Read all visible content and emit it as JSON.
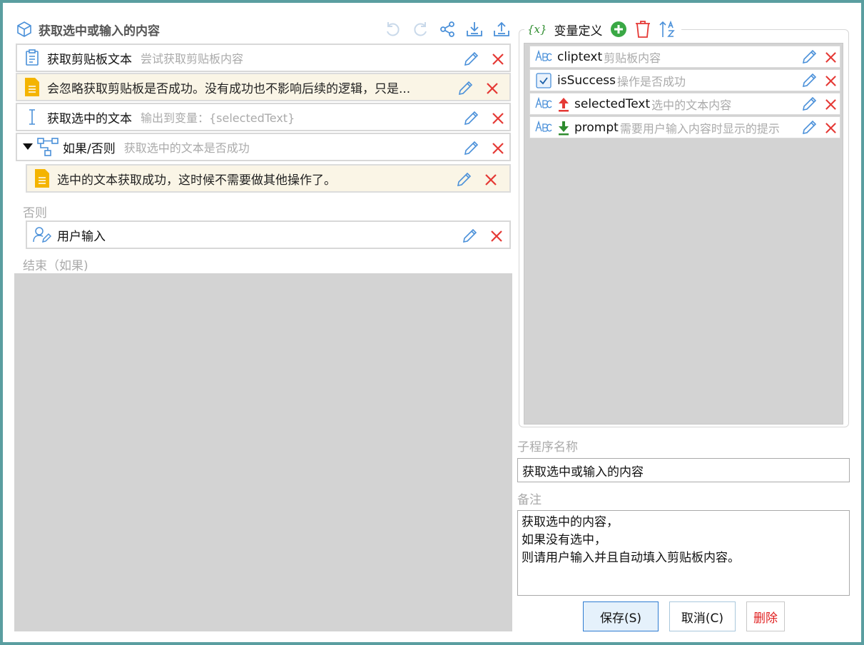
{
  "header": {
    "title": "获取选中或输入的内容"
  },
  "steps": [
    {
      "name": "获取剪贴板文本",
      "desc": "尝试获取剪贴板内容"
    },
    {
      "note": "会忽略获取剪贴板是否成功。没有成功也不影响后续的逻辑，只是..."
    },
    {
      "name": "获取选中的文本",
      "desc": "输出到变量：{selectedText}"
    },
    {
      "name": "如果/否则",
      "desc": "获取选中的文本是否成功"
    },
    {
      "note": "选中的文本获取成功，这时候不需要做其他操作了。"
    },
    {
      "label": "否则"
    },
    {
      "name": "用户输入"
    },
    {
      "label": "结束（如果)"
    }
  ],
  "vars_panel": {
    "icon_text": "{x}",
    "title": "变量定义",
    "items": [
      {
        "name": "cliptext",
        "desc": "剪贴板内容",
        "type": "text-icon"
      },
      {
        "name": "isSuccess",
        "desc": "操作是否成功",
        "type": "checkbox-icon"
      },
      {
        "name": "selectedText",
        "desc": "选中的文本内容",
        "type": "text-icon",
        "direction": "output"
      },
      {
        "name": "prompt",
        "desc": "需要用户输入内容时显示的提示",
        "type": "text-icon",
        "direction": "input"
      }
    ]
  },
  "form": {
    "name_label": "子程序名称",
    "name_value": "获取选中或输入的内容",
    "memo_label": "备注",
    "memo_value": "获取选中的内容，\n如果没有选中，\n则请用户输入并且自动填入剪贴板内容。"
  },
  "buttons": {
    "save": "保存(S)",
    "cancel": "取消(C)",
    "delete": "删除"
  },
  "colors": {
    "frame": "#5a9ea0",
    "edit": "#4a90d9",
    "delete": "#e53935",
    "add": "#3aa845",
    "note_bg": "#faf5e6",
    "note_icon": "#f4b400",
    "output_arrow": "#e53935",
    "input_arrow": "#2e8b2e"
  }
}
